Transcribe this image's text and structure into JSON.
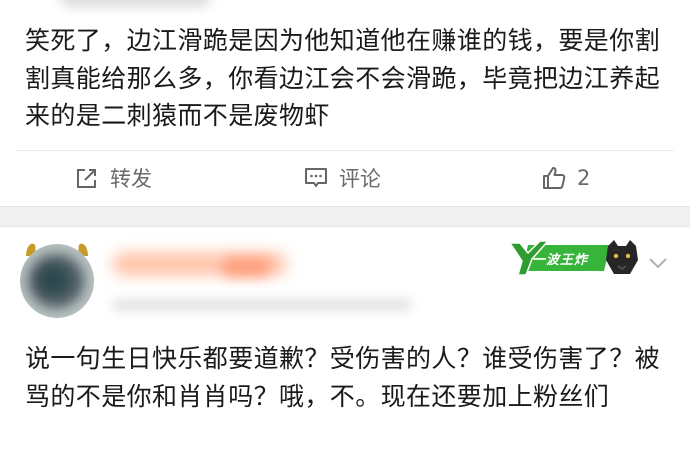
{
  "post1": {
    "text": "笑死了，边江滑跪是因为他知道他在赚谁的钱，要是你割割真能给那么多，你看边江会不会滑跪，毕竟把边江养起来的是二刺猿而不是废物虾"
  },
  "actions": {
    "repost_label": "转发",
    "comment_label": "评论",
    "like_count": "2",
    "repost_icon": "share-icon",
    "comment_icon": "comment-icon",
    "like_icon": "thumbs-up-icon"
  },
  "post2": {
    "badge_label": "一波王炸",
    "badge_color": "#37b53a",
    "text": "说一句生日快乐都要道歉？受伤害的人？谁受伤害了？被骂的不是你和肖肖吗？哦，不。现在还要加上粉丝们"
  }
}
